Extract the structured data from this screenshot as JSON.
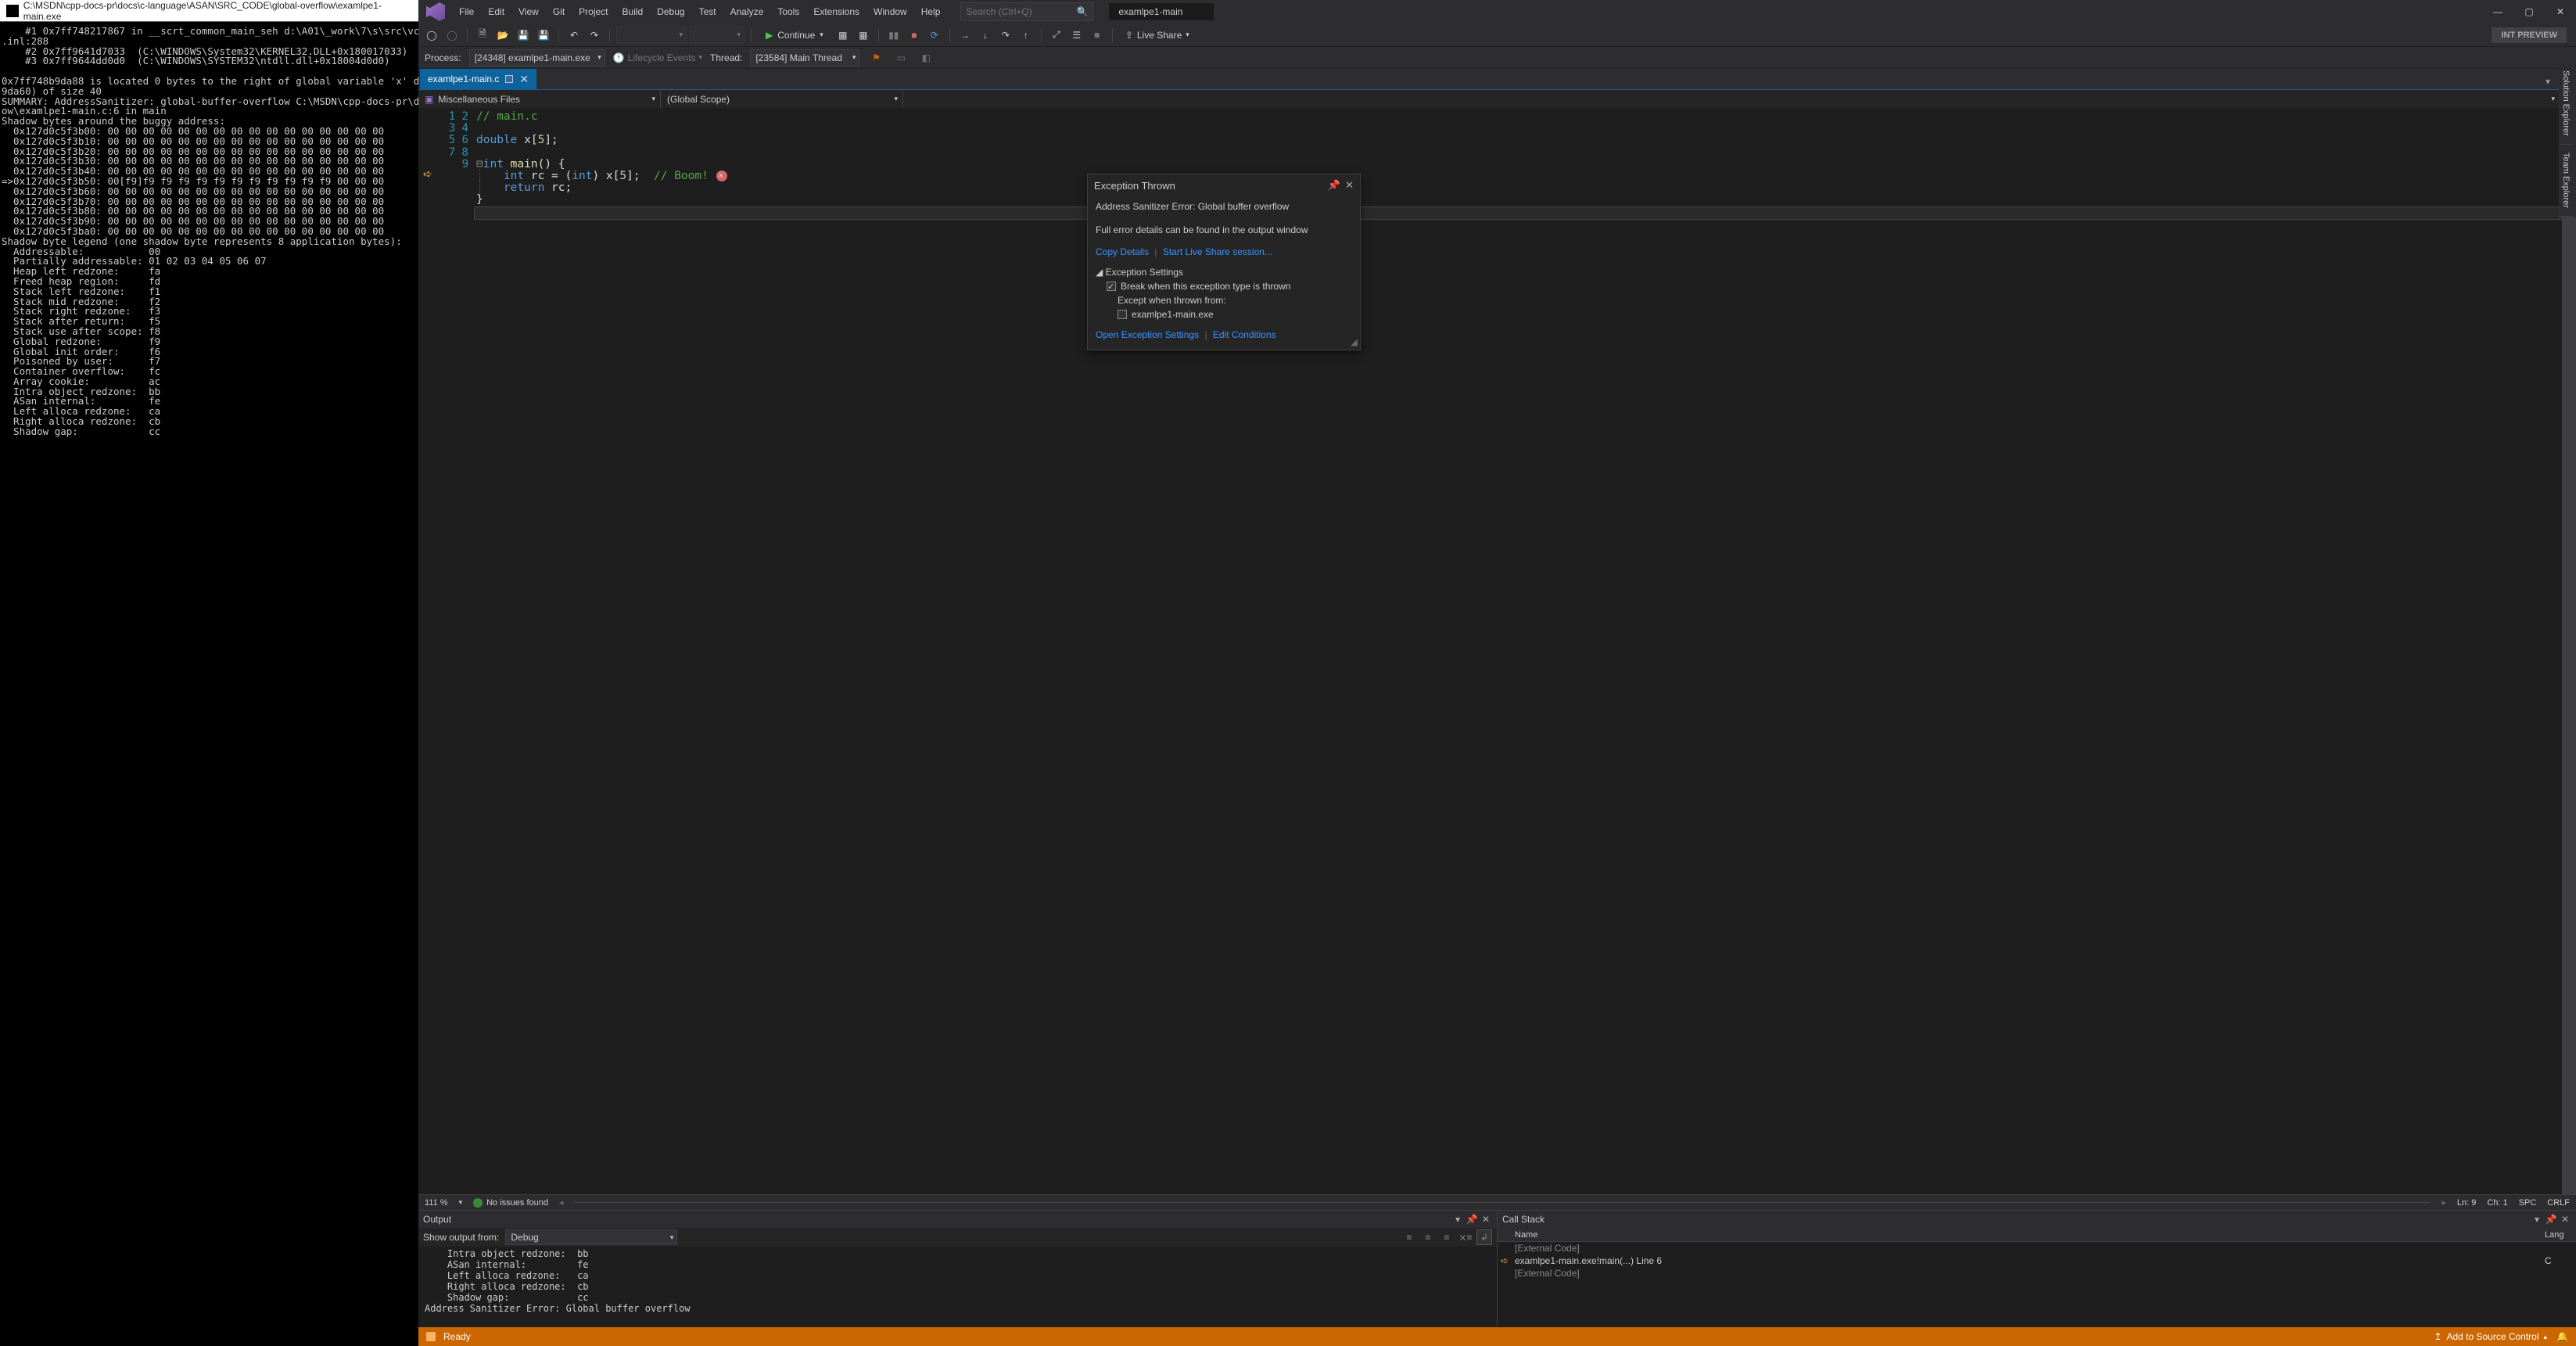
{
  "console": {
    "title": "C:\\MSDN\\cpp-docs-pr\\docs\\c-language\\ASAN\\SRC_CODE\\global-overflow\\examlpe1-main.exe",
    "body": "    #1 0x7ff748217867 in __scrt_common_main_seh d:\\A01\\_work\\7\\s\\src\\vctools\\crt\\vcstartu\n.inl:288\n    #2 0x7ff9641d7033  (C:\\WINDOWS\\System32\\KERNEL32.DLL+0x180017033)\n    #3 0x7ff9644dd0d0  (C:\\WINDOWS\\SYSTEM32\\ntdll.dll+0x18004d0d0)\n\n0x7ff748b9da88 is located 0 bytes to the right of global variable 'x' defined in 'examlpe\n9da60) of size 40\nSUMMARY: AddressSanitizer: global-buffer-overflow C:\\MSDN\\cpp-docs-pr\\docs\\c-language\\ASA\now\\examlpe1-main.c:6 in main\nShadow bytes around the buggy address:\n  0x127d0c5f3b00: 00 00 00 00 00 00 00 00 00 00 00 00 00 00 00 00\n  0x127d0c5f3b10: 00 00 00 00 00 00 00 00 00 00 00 00 00 00 00 00\n  0x127d0c5f3b20: 00 00 00 00 00 00 00 00 00 00 00 00 00 00 00 00\n  0x127d0c5f3b30: 00 00 00 00 00 00 00 00 00 00 00 00 00 00 00 00\n  0x127d0c5f3b40: 00 00 00 00 00 00 00 00 00 00 00 00 00 00 00 00\n=>0x127d0c5f3b50: 00[f9]f9 f9 f9 f9 f9 f9 f9 f9 f9 f9 f9 00 00 00\n  0x127d0c5f3b60: 00 00 00 00 00 00 00 00 00 00 00 00 00 00 00 00\n  0x127d0c5f3b70: 00 00 00 00 00 00 00 00 00 00 00 00 00 00 00 00\n  0x127d0c5f3b80: 00 00 00 00 00 00 00 00 00 00 00 00 00 00 00 00\n  0x127d0c5f3b90: 00 00 00 00 00 00 00 00 00 00 00 00 00 00 00 00\n  0x127d0c5f3ba0: 00 00 00 00 00 00 00 00 00 00 00 00 00 00 00 00\nShadow byte legend (one shadow byte represents 8 application bytes):\n  Addressable:           00\n  Partially addressable: 01 02 03 04 05 06 07\n  Heap left redzone:     fa\n  Freed heap region:     fd\n  Stack left redzone:    f1\n  Stack mid redzone:     f2\n  Stack right redzone:   f3\n  Stack after return:    f5\n  Stack use after scope: f8\n  Global redzone:        f9\n  Global init order:     f6\n  Poisoned by user:      f7\n  Container overflow:    fc\n  Array cookie:          ac\n  Intra object redzone:  bb\n  ASan internal:         fe\n  Left alloca redzone:   ca\n  Right alloca redzone:  cb\n  Shadow gap:            cc"
  },
  "menu": [
    "File",
    "Edit",
    "View",
    "Git",
    "Project",
    "Build",
    "Debug",
    "Test",
    "Analyze",
    "Tools",
    "Extensions",
    "Window",
    "Help"
  ],
  "search_placeholder": "Search (Ctrl+Q)",
  "doc_title": "examlpe1-main",
  "continue_label": "Continue",
  "int_preview": "INT PREVIEW",
  "live_share": "Live Share",
  "process_label": "Process:",
  "process_value": "[24348] examlpe1-main.exe",
  "lifecycle_label": "Lifecycle Events",
  "thread_label": "Thread:",
  "thread_value": "[23584] Main Thread",
  "file_tab": "examlpe1-main.c",
  "scope_left": "Miscellaneous Files",
  "scope_mid": "(Global Scope)",
  "code_lines": 9,
  "editor_status": {
    "zoom": "111 %",
    "issues": "No issues found",
    "ln": "Ln: 9",
    "ch": "Ch: 1",
    "spc": "SPC",
    "crlf": "CRLF"
  },
  "exception": {
    "title": "Exception Thrown",
    "msg": "Address Sanitizer Error: Global buffer overflow",
    "details": "Full error details can be found in the output window",
    "copy": "Copy Details",
    "start_ls": "Start Live Share session...",
    "settings_hdr": "Exception Settings",
    "break_label": "Break when this exception type is thrown",
    "except_label": "Except when thrown from:",
    "except_item": "examlpe1-main.exe",
    "open_settings": "Open Exception Settings",
    "edit_cond": "Edit Conditions"
  },
  "output": {
    "title": "Output",
    "show_from": "Show output from:",
    "combo": "Debug",
    "body": "    Intra object redzone:  bb\n    ASan internal:         fe\n    Left alloca redzone:   ca\n    Right alloca redzone:  cb\n    Shadow gap:            cc\nAddress Sanitizer Error: Global buffer overflow\n"
  },
  "callstack": {
    "title": "Call Stack",
    "col_name": "Name",
    "col_lang": "Lang",
    "rows": [
      {
        "txt": "[External Code]",
        "lang": "",
        "ext": true,
        "cur": false
      },
      {
        "txt": "examlpe1-main.exe!main(...) Line 6",
        "lang": "C",
        "ext": false,
        "cur": true
      },
      {
        "txt": "[External Code]",
        "lang": "",
        "ext": true,
        "cur": false
      }
    ]
  },
  "status": {
    "ready": "Ready",
    "src": "Add to Source Control"
  },
  "side_tabs": [
    "Solution Explorer",
    "Team Explorer"
  ]
}
